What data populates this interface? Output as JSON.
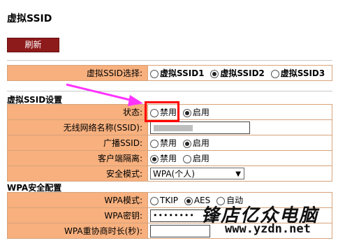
{
  "title": "虚拟SSID",
  "refresh_label": "刷新",
  "select_row": {
    "label": "虚拟SSID选择:",
    "options": [
      "虚拟SSID1",
      "虚拟SSID2",
      "虚拟SSID3"
    ],
    "selected": 1
  },
  "ssid_section": "虚拟SSID设置",
  "status": {
    "label": "状态:",
    "options": [
      "禁用",
      "启用"
    ],
    "selected": 1
  },
  "ssid_name": {
    "label": "无线网络名称(SSID):"
  },
  "broadcast": {
    "label": "广播SSID:",
    "options": [
      "禁用",
      "启用"
    ],
    "selected": 1
  },
  "isolation": {
    "label": "客户端隔离:",
    "options": [
      "禁用",
      "启用"
    ],
    "selected": 0
  },
  "security_mode": {
    "label": "安全模式:",
    "value": "WPA(个人)"
  },
  "wpa_section": "WPA安全配置",
  "wpa_mode": {
    "label": "WPA模式:",
    "options": [
      "TKIP",
      "AES",
      "自动"
    ],
    "selected": 1
  },
  "wpa_key": {
    "label": "WPA密钥:",
    "value": "••••••••"
  },
  "wpa_rekey": {
    "label": "WPA重协商时长(秒):"
  },
  "watermark": {
    "brand": "锋店亿众电脑",
    "url": "www.yzdn.net"
  },
  "colors": {
    "label_bg": "#f7b07e",
    "refresh_bg": "#8e1b1b",
    "arrow": "#ff33ff",
    "highlight": "#ff0000"
  }
}
